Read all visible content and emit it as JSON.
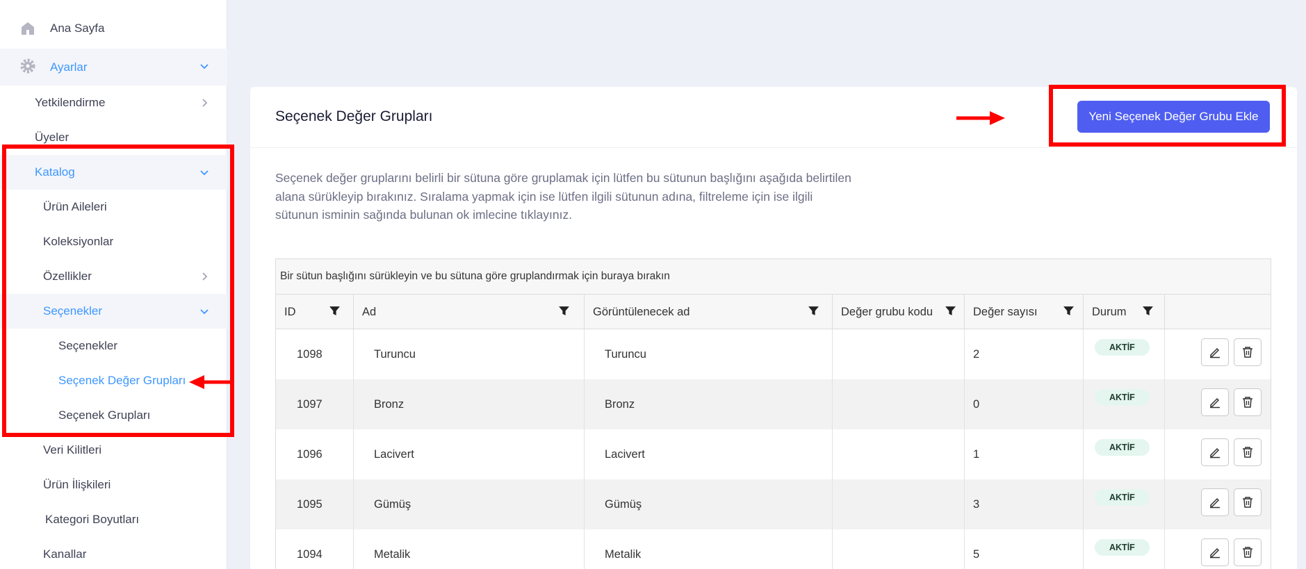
{
  "sidebar": {
    "home": "Ana Sayfa",
    "settings": "Ayarlar",
    "authorization": "Yetkilendirme",
    "members": "Üyeler",
    "catalog": "Katalog",
    "product_families": "Ürün Aileleri",
    "collections": "Koleksiyonlar",
    "attributes": "Özellikler",
    "options_group": "Seçenekler",
    "options": "Seçenekler",
    "option_value_groups": "Seçenek Değer Grupları",
    "option_groups": "Seçenek Grupları",
    "data_locks": "Veri Kilitleri",
    "product_relations": "Ürün İlişkileri",
    "category_dimensions": "Kategori Boyutları",
    "channels": "Kanallar"
  },
  "main": {
    "title": "Seçenek Değer Grupları",
    "add_button": "Yeni Seçenek Değer Grubu Ekle",
    "description": "Seçenek değer gruplarını belirli bir sütuna göre gruplamak için lütfen bu sütunun başlığını aşağıda belirtilen alana sürükleyip bırakınız. Sıralama yapmak için ise lütfen ilgili sütunun adına, filtreleme için ise ilgili sütunun isminin sağında bulunan ok imlecine tıklayınız."
  },
  "grid": {
    "group_panel": "Bir sütun başlığını sürükleyin ve bu sütuna göre gruplandırmak için buraya bırakın",
    "columns": [
      "ID",
      "Ad",
      "Görüntülenecek ad",
      "Değer grubu kodu",
      "Değer sayısı",
      "Durum"
    ],
    "rows": [
      {
        "id": "1098",
        "name": "Turuncu",
        "display": "Turuncu",
        "code": "",
        "count": "2",
        "status": "AKTİF"
      },
      {
        "id": "1097",
        "name": "Bronz",
        "display": "Bronz",
        "code": "",
        "count": "0",
        "status": "AKTİF"
      },
      {
        "id": "1096",
        "name": "Lacivert",
        "display": "Lacivert",
        "code": "",
        "count": "1",
        "status": "AKTİF"
      },
      {
        "id": "1095",
        "name": "Gümüş",
        "display": "Gümüş",
        "code": "",
        "count": "3",
        "status": "AKTİF"
      },
      {
        "id": "1094",
        "name": "Metalik",
        "display": "Metalik",
        "code": "",
        "count": "5",
        "status": "AKTİF"
      }
    ]
  },
  "colors": {
    "accent": "#3e97ff",
    "button": "#4f5ef0",
    "annotation": "#ff0000",
    "badge_bg": "#e4f6ef"
  }
}
